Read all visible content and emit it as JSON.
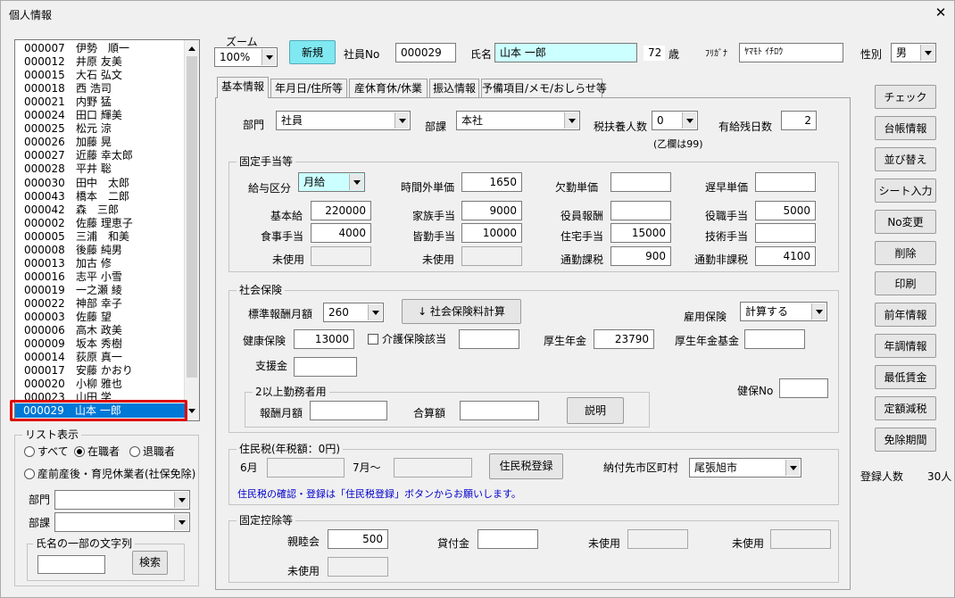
{
  "window": {
    "title": "個人情報",
    "close": "✕"
  },
  "employee_list": [
    {
      "code": "000007",
      "name": "伊勢　順一"
    },
    {
      "code": "000012",
      "name": "井原 友美"
    },
    {
      "code": "000015",
      "name": "大石 弘文"
    },
    {
      "code": "000018",
      "name": "西 浩司"
    },
    {
      "code": "000021",
      "name": "内野 猛"
    },
    {
      "code": "000024",
      "name": "田口 輝美"
    },
    {
      "code": "000025",
      "name": "松元 涼"
    },
    {
      "code": "000026",
      "name": "加藤 晃"
    },
    {
      "code": "000027",
      "name": "近藤 幸太郎"
    },
    {
      "code": "000028",
      "name": "平井 聡"
    },
    {
      "code": "000030",
      "name": "田中　太郎"
    },
    {
      "code": "000043",
      "name": "橋本　二郎"
    },
    {
      "code": "000042",
      "name": "森　三郎"
    },
    {
      "code": "000002",
      "name": "佐藤 理恵子"
    },
    {
      "code": "000005",
      "name": "三浦　和美"
    },
    {
      "code": "000008",
      "name": "後藤 純男"
    },
    {
      "code": "000013",
      "name": "加古 修"
    },
    {
      "code": "000016",
      "name": "志平 小雪"
    },
    {
      "code": "000019",
      "name": "一之瀬 綾"
    },
    {
      "code": "000022",
      "name": "神部 幸子"
    },
    {
      "code": "000003",
      "name": "佐藤 望"
    },
    {
      "code": "000006",
      "name": "高木 政美"
    },
    {
      "code": "000009",
      "name": "坂本 秀樹"
    },
    {
      "code": "000014",
      "name": "荻原 真一"
    },
    {
      "code": "000017",
      "name": "安藤 かおり"
    },
    {
      "code": "000020",
      "name": "小柳 雅也"
    },
    {
      "code": "000023",
      "name": "山田 学"
    }
  ],
  "selected_item": {
    "code": "000029",
    "name": "山本 一郎"
  },
  "list_filter": {
    "title": "リスト表示",
    "opt_all": "すべて",
    "opt_active": "在職者",
    "opt_retired": "退職者",
    "opt_maternity": "産前産後・育児休業者(社保免除)",
    "dept_label": "部門",
    "section_label": "部課",
    "name_search_title": "氏名の一部の文字列",
    "search_button": "検索"
  },
  "header": {
    "zoom_label": "ズーム",
    "zoom_value": "100%",
    "new_button": "新規",
    "emp_no_label": "社員No",
    "emp_no": "000029",
    "name_label": "氏名",
    "name": "山本 一郎",
    "age": "72",
    "age_unit": "歳",
    "kana_label": "ﾌﾘｶﾞﾅ",
    "kana": "ﾔﾏﾓﾄ ｲﾁﾛｳ",
    "gender_label": "性別",
    "gender": "男"
  },
  "tabs": [
    "基本情報",
    "年月日/住所等",
    "産休育休/休業",
    "振込情報",
    "予備項目/メモ/おしらせ等"
  ],
  "basic": {
    "dept_label": "部門",
    "dept": "社員",
    "section_label": "部課",
    "section": "本社",
    "dependents_label": "税扶養人数",
    "dependents": "0",
    "dependents_note": "(乙欄は99)",
    "paid_leave_label": "有給残日数",
    "paid_leave": "2"
  },
  "allowance": {
    "title": "固定手当等",
    "pay_type_label": "給与区分",
    "pay_type": "月給",
    "overtime_rate_label": "時間外単価",
    "overtime_rate": "1650",
    "absence_rate_label": "欠勤単価",
    "absence_rate": "",
    "late_rate_label": "遅早単価",
    "late_rate": "",
    "base_pay_label": "基本給",
    "base_pay": "220000",
    "family_label": "家族手当",
    "family": "9000",
    "officer_pay_label": "役員報酬",
    "officer_pay": "",
    "position_label": "役職手当",
    "position": "5000",
    "meal_label": "食事手当",
    "meal": "4000",
    "attendance_label": "皆勤手当",
    "attendance": "10000",
    "housing_label": "住宅手当",
    "housing": "15000",
    "skill_label": "技術手当",
    "skill": "",
    "unused1_label": "未使用",
    "unused2_label": "未使用",
    "commute_tax_label": "通勤課税",
    "commute_tax": "900",
    "commute_notax_label": "通勤非課税",
    "commute_notax": "4100"
  },
  "social": {
    "title": "社会保険",
    "std_monthly_label": "標準報酬月額",
    "std_monthly": "260",
    "calc_button": "↓ 社会保険料計算",
    "employment_ins_label": "雇用保険",
    "employment_ins": "計算する",
    "health_label": "健康保険",
    "health": "13000",
    "care_label": "介護保険該当",
    "care": "",
    "pension_label": "厚生年金",
    "pension": "23790",
    "pension_fund_label": "厚生年金基金",
    "pension_fund": "",
    "support_label": "支援金",
    "support": "",
    "multi_title": "2以上勤務者用",
    "remun_label": "報酬月額",
    "remun": "",
    "total_label": "合算額",
    "total": "",
    "explain_button": "説明",
    "health_no_label": "健保No",
    "health_no": ""
  },
  "resident": {
    "title": "住民税(年税額：0円)",
    "june_label": "6月",
    "june": "",
    "july_label": "7月～",
    "july": "",
    "register_button": "住民税登録",
    "city_label": "納付先市区町村",
    "city": "尾張旭市",
    "note": "住民税の確認・登録は「住民税登録」ボタンからお願いします。"
  },
  "deduction": {
    "title": "固定控除等",
    "club_label": "親睦会",
    "club": "500",
    "loan_label": "貸付金",
    "loan": "",
    "unused1_label": "未使用",
    "unused2_label": "未使用",
    "unused3_label": "未使用"
  },
  "side_buttons": [
    "チェック",
    "台帳情報",
    "並び替え",
    "シート入力",
    "No変更",
    "削除",
    "印刷",
    "前年情報",
    "年調情報",
    "最低賃金",
    "定額減税",
    "免除期間"
  ],
  "registered": {
    "label": "登録人数",
    "count": "30人"
  },
  "colors": {
    "selection": "#0078d7",
    "highlight_border": "#e00000",
    "cyan_field": "#ccffff",
    "new_button": "#7fe8f0"
  }
}
